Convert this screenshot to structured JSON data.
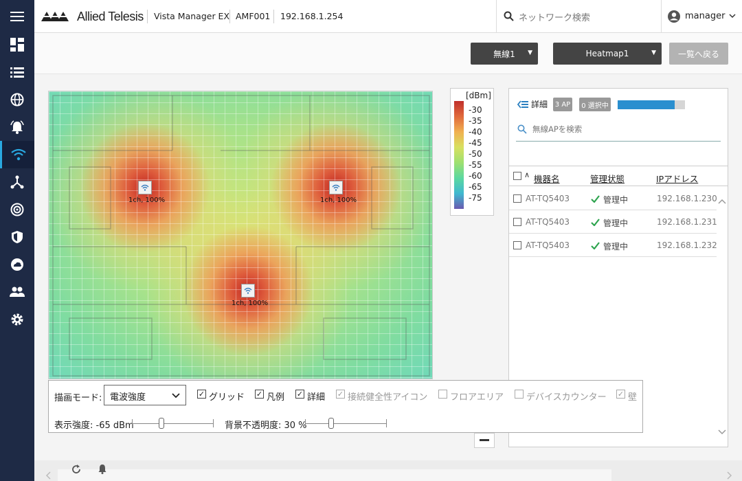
{
  "header": {
    "logo_text": "Allied Telesis",
    "app_name": "Vista Manager EX",
    "device": "AMF001",
    "ip": "192.168.1.254",
    "search_placeholder": "ネットワーク検索",
    "user": "manager"
  },
  "toolbar": {
    "radio_dropdown": "無線1",
    "heatmap_dropdown": "Heatmap1",
    "back_button": "一覧へ戻る"
  },
  "map": {
    "aps": [
      {
        "label": "1ch, 100%"
      },
      {
        "label": "1ch, 100%"
      },
      {
        "label": "1ch, 100%"
      }
    ]
  },
  "legend": {
    "unit": "[dBm]",
    "ticks": [
      "-30",
      "-35",
      "-40",
      "-45",
      "-50",
      "-55",
      "-60",
      "-65",
      "-75"
    ]
  },
  "panel": {
    "detail_label": "詳細",
    "ap_count_badge": "3 AP",
    "selected_badge": "0 選択中",
    "progress_fraction": 0.85,
    "search_placeholder": "無線APを検索",
    "columns": [
      "機器名",
      "管理状態",
      "IPアドレス"
    ],
    "rows": [
      {
        "name": "AT-TQ5403",
        "status": "管理中",
        "ip": "192.168.1.230"
      },
      {
        "name": "AT-TQ5403",
        "status": "管理中",
        "ip": "192.168.1.231"
      },
      {
        "name": "AT-TQ5403",
        "status": "管理中",
        "ip": "192.168.1.232"
      }
    ]
  },
  "controls": {
    "mode_label": "描画モード:",
    "mode_value": "電波強度",
    "grid": "グリッド",
    "legend": "凡例",
    "detail": "詳細",
    "health_icon": "接続健全性アイコン",
    "floor_area": "フロアエリア",
    "device_counter": "デバイスカウンター",
    "wall": "壁",
    "strength_label": "表示強度: -65 dBm",
    "opacity_label": "背景不透明度: 30 %"
  },
  "colors": {
    "nav_bg": "#1e2a45",
    "accent": "#29a8e0",
    "check_green": "#2ea44f"
  }
}
